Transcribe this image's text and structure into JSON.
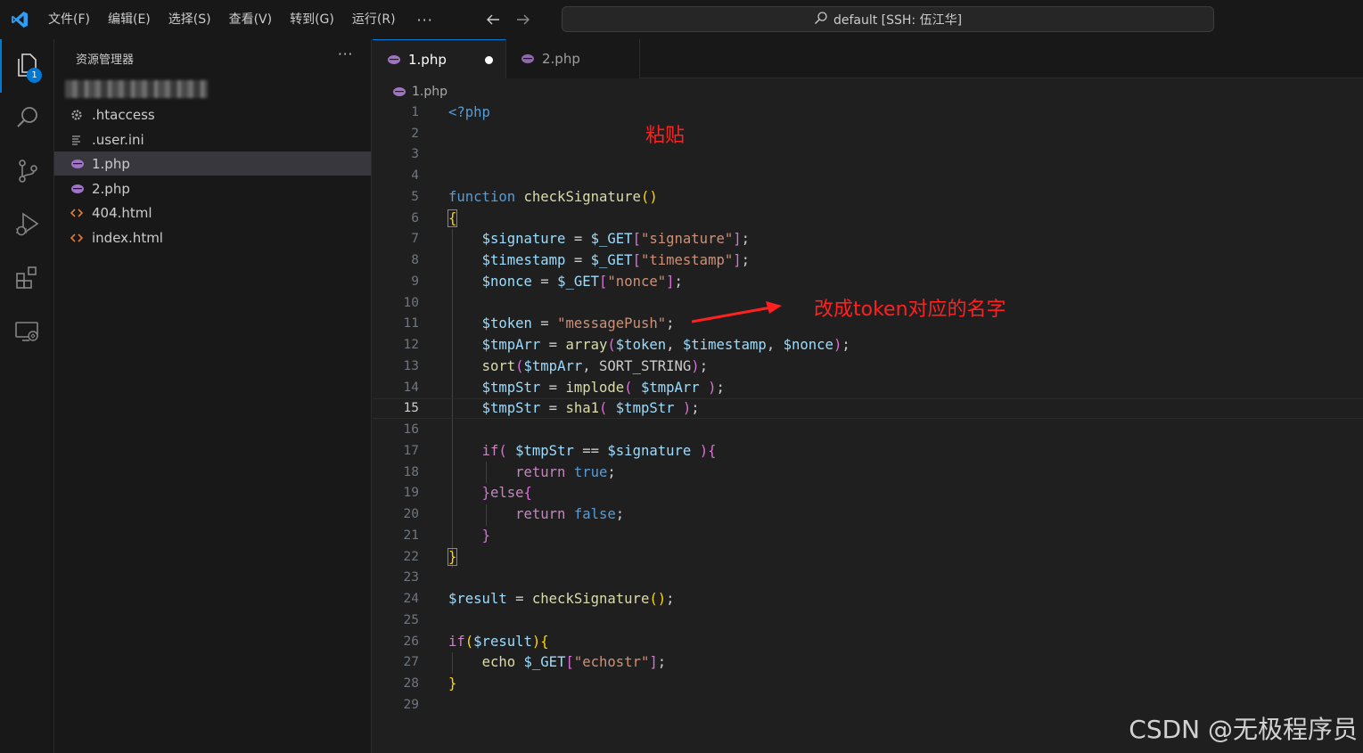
{
  "menu": [
    "文件(F)",
    "编辑(E)",
    "选择(S)",
    "查看(V)",
    "转到(G)",
    "运行(R)"
  ],
  "menu_more": "···",
  "command_center": "default [SSH: 伍江华]",
  "activity": {
    "explorer_badge": "1"
  },
  "sidebar": {
    "title": "资源管理器",
    "more": "···",
    "files": [
      {
        "name": ".htaccess",
        "icon": "gear-icon"
      },
      {
        "name": ".user.ini",
        "icon": "lines-icon"
      },
      {
        "name": "1.php",
        "icon": "php-icon"
      },
      {
        "name": "2.php",
        "icon": "php-icon"
      },
      {
        "name": "404.html",
        "icon": "html-icon"
      },
      {
        "name": "index.html",
        "icon": "html-icon"
      }
    ]
  },
  "tabs": [
    {
      "label": "1.php",
      "active": true,
      "dirty": true
    },
    {
      "label": "2.php",
      "active": false,
      "dirty": false
    }
  ],
  "breadcrumb": "1.php",
  "current_line": 15,
  "line_numbers": [
    "1",
    "2",
    "3",
    "4",
    "5",
    "6",
    "7",
    "8",
    "9",
    "10",
    "11",
    "12",
    "13",
    "14",
    "15",
    "16",
    "17",
    "18",
    "19",
    "20",
    "21",
    "22",
    "23",
    "24",
    "25",
    "26",
    "27",
    "28",
    "29"
  ],
  "annotations": {
    "paste": "粘贴",
    "rename": "改成token对应的名字"
  },
  "watermark": "CSDN @无极程序员",
  "colors": {
    "accent": "#0078d4",
    "annotation": "#ff2020"
  }
}
